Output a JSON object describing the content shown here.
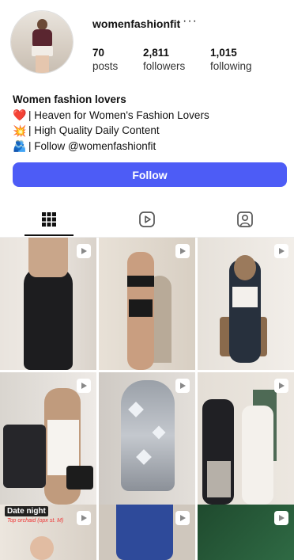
{
  "profile": {
    "username": "womenfashionfit",
    "more_icon": "···",
    "stats": {
      "posts": {
        "value": "70",
        "label": "posts"
      },
      "followers": {
        "value": "2,811",
        "label": "followers"
      },
      "following": {
        "value": "1,015",
        "label": "following"
      }
    }
  },
  "bio": {
    "name": "Women fashion lovers",
    "lines": [
      {
        "icon": "heart-icon",
        "glyph": "❤️",
        "text": "| Heaven for Women's Fashion Lovers"
      },
      {
        "icon": "sparkle-icon",
        "glyph": "💥",
        "text": "| High Quality Daily Content"
      },
      {
        "icon": "people-hugging-icon",
        "glyph": "🫂",
        "text": "| Follow @womenfashionfit"
      }
    ]
  },
  "follow_button": {
    "label": "Follow",
    "color": "#4d5cf6"
  },
  "tabs": [
    {
      "name": "posts-grid",
      "icon": "grid-icon",
      "active": true
    },
    {
      "name": "reels",
      "icon": "reels-icon",
      "active": false
    },
    {
      "name": "tagged",
      "icon": "tagged-user-icon",
      "active": false
    }
  ],
  "grid": {
    "tiles": [
      {
        "kind": "reel",
        "caption": ""
      },
      {
        "kind": "reel",
        "caption": ""
      },
      {
        "kind": "reel",
        "caption": ""
      },
      {
        "kind": "reel",
        "caption": ""
      },
      {
        "kind": "reel",
        "caption": ""
      },
      {
        "kind": "reel",
        "caption": ""
      },
      {
        "kind": "reel",
        "caption": "Date night",
        "subcaption": "Top orchaid (opx st. M)"
      },
      {
        "kind": "reel",
        "caption": ""
      },
      {
        "kind": "reel",
        "caption": ""
      }
    ]
  }
}
